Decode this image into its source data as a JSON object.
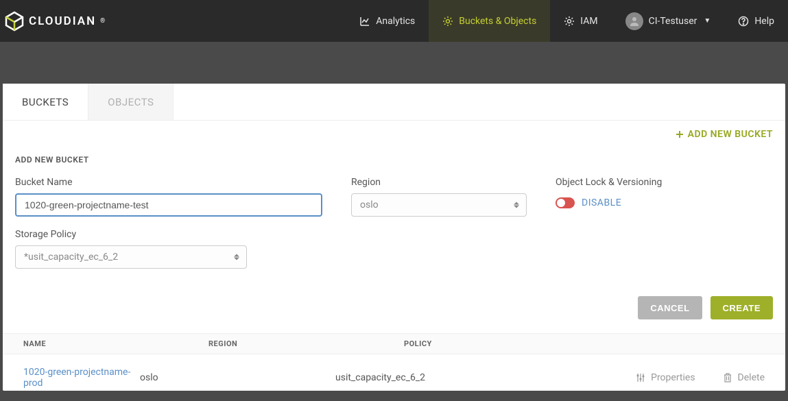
{
  "brand": "CLOUDIAN",
  "nav": {
    "analytics": "Analytics",
    "buckets": "Buckets & Objects",
    "iam": "IAM",
    "user": "CI-Testuser",
    "help": "Help"
  },
  "tabs": {
    "buckets": "BUCKETS",
    "objects": "OBJECTS"
  },
  "add_new_bucket_link": "ADD NEW BUCKET",
  "form": {
    "title": "ADD NEW BUCKET",
    "bucket_name_label": "Bucket Name",
    "bucket_name_value": "1020-green-projectname-test",
    "region_label": "Region",
    "region_value": "oslo",
    "lock_label": "Object Lock & Versioning",
    "lock_toggle": "DISABLE",
    "policy_label": "Storage Policy",
    "policy_value": "*usit_capacity_ec_6_2"
  },
  "buttons": {
    "cancel": "CANCEL",
    "create": "CREATE"
  },
  "table": {
    "headers": {
      "name": "NAME",
      "region": "REGION",
      "policy": "POLICY"
    },
    "row": {
      "name": "1020-green-projectname-prod",
      "region": "oslo",
      "policy": "usit_capacity_ec_6_2"
    },
    "actions": {
      "properties": "Properties",
      "delete": "Delete"
    }
  }
}
